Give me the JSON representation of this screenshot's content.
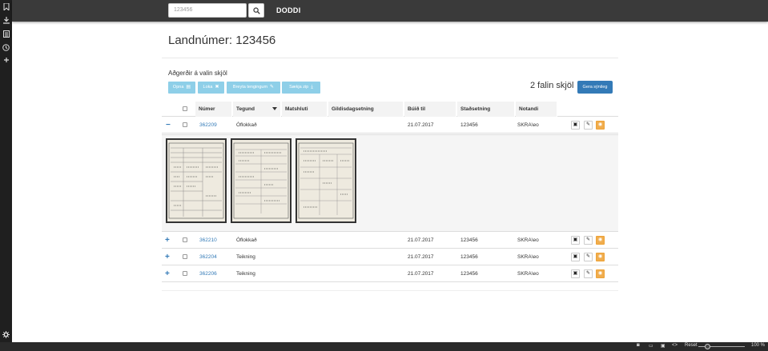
{
  "search": {
    "placeholder": "123456",
    "value": ""
  },
  "brand": "DODDI",
  "page_title": "Landnúmer: 123456",
  "actions": {
    "label": "Aðgerðir á valin skjöl",
    "buttons": [
      "Opna",
      "Loka",
      "Breyta tengingum",
      "Sækja zip"
    ]
  },
  "found_count": "2 falin skjöl",
  "viewer_button": "Gera sýnileg",
  "table": {
    "headers": [
      "Númer",
      "Tegund",
      "Matshluti",
      "Gildisdagsetning",
      "Búið til",
      "Staðsetning",
      "Notandi"
    ],
    "rows": [
      {
        "toggle": "−",
        "number": "362209",
        "type": "Óflokkað",
        "part": "",
        "valid": "",
        "created": "21.07.2017",
        "location": "123456",
        "user": "SKRA\\eo"
      },
      {
        "toggle": "+",
        "number": "362210",
        "type": "Óflokkað",
        "part": "",
        "valid": "",
        "created": "21.07.2017",
        "location": "123456",
        "user": "SKRA\\eo"
      },
      {
        "toggle": "+",
        "number": "362204",
        "type": "Teikning",
        "part": "",
        "valid": "",
        "created": "21.07.2017",
        "location": "123456",
        "user": "SKRA\\eo"
      },
      {
        "toggle": "+",
        "number": "362206",
        "type": "Teikning",
        "part": "",
        "valid": "",
        "created": "21.07.2017",
        "location": "123456",
        "user": "SKRA\\eo"
      }
    ]
  },
  "statusbar": {
    "reset": "Reset",
    "zoom": "100 %"
  },
  "colors": {
    "primary": "#337ab7",
    "action": "#8ecfe8",
    "warning": "#f0ad4e",
    "topbar": "#3a3a3a"
  }
}
